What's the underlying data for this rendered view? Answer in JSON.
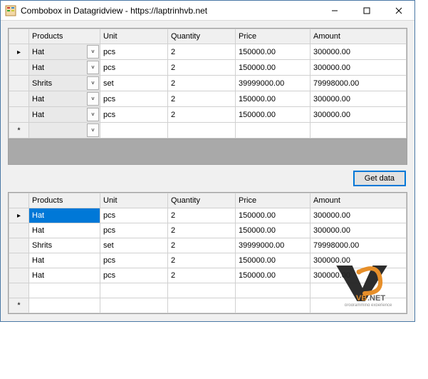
{
  "window": {
    "title": "Combobox in Datagridview - https://laptrinhvb.net"
  },
  "columns": {
    "products": "Products",
    "unit": "Unit",
    "quantity": "Quantity",
    "price": "Price",
    "amount": "Amount"
  },
  "grid1": {
    "rows": [
      {
        "product": "Hat",
        "unit": "pcs",
        "qty": "2",
        "price": "150000.00",
        "amount": "300000.00"
      },
      {
        "product": "Hat",
        "unit": "pcs",
        "qty": "2",
        "price": "150000.00",
        "amount": "300000.00"
      },
      {
        "product": "Shrits",
        "unit": "set",
        "qty": "2",
        "price": "39999000.00",
        "amount": "79998000.00"
      },
      {
        "product": "Hat",
        "unit": "pcs",
        "qty": "2",
        "price": "150000.00",
        "amount": "300000.00"
      },
      {
        "product": "Hat",
        "unit": "pcs",
        "qty": "2",
        "price": "150000.00",
        "amount": "300000.00"
      }
    ]
  },
  "grid2": {
    "rows": [
      {
        "product": "Hat",
        "unit": "pcs",
        "qty": "2",
        "price": "150000.00",
        "amount": "300000.00"
      },
      {
        "product": "Hat",
        "unit": "pcs",
        "qty": "2",
        "price": "150000.00",
        "amount": "300000.00"
      },
      {
        "product": "Shrits",
        "unit": "set",
        "qty": "2",
        "price": "39999000.00",
        "amount": "79998000.00"
      },
      {
        "product": "Hat",
        "unit": "pcs",
        "qty": "2",
        "price": "150000.00",
        "amount": "300000.00"
      },
      {
        "product": "Hat",
        "unit": "pcs",
        "qty": "2",
        "price": "150000.00",
        "amount": "300000.00"
      }
    ]
  },
  "buttons": {
    "get_data": "Get data"
  },
  "branding": {
    "name": "VB.NET",
    "tagline": "programming experience"
  }
}
